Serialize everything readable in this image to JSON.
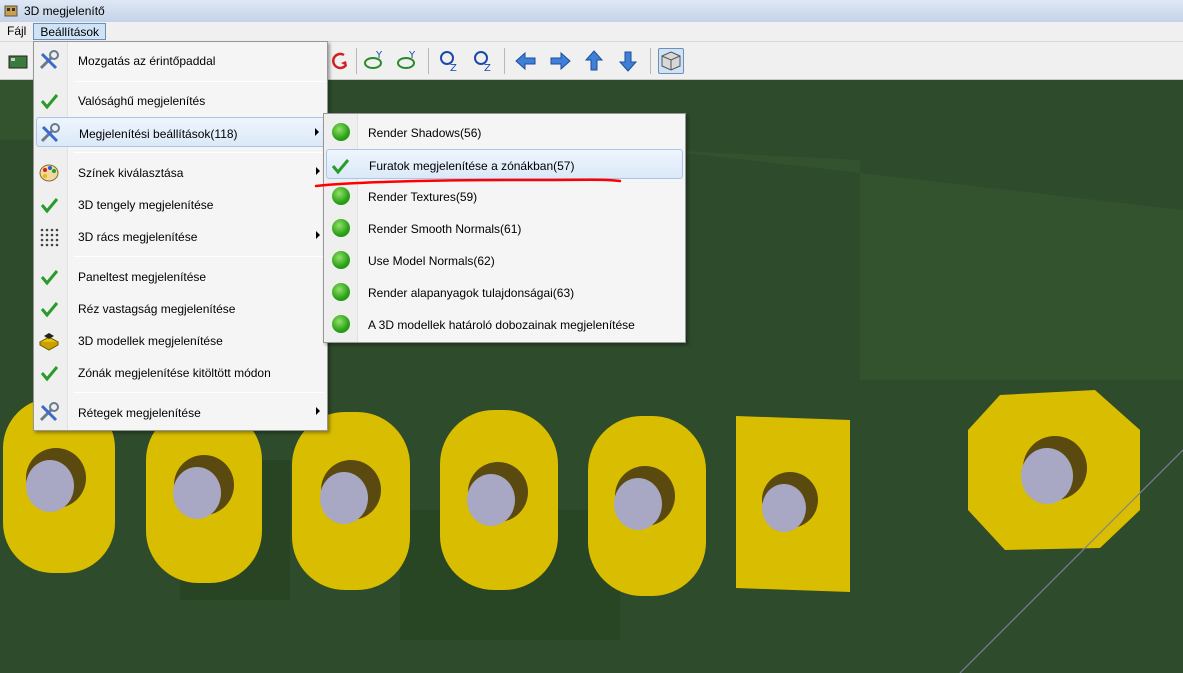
{
  "window": {
    "title": "3D megjelenítő"
  },
  "menubar": {
    "items": [
      "Fájl",
      "Beállítások"
    ]
  },
  "main_menu": {
    "items": [
      {
        "label": "Mozgatás az érintőpaddal",
        "icon": "tools-icon",
        "has_submenu": false
      },
      {
        "label": "Valósághű megjelenítés",
        "icon": "check-icon",
        "has_submenu": false
      },
      {
        "label": "Megjelenítési beállítások(118)",
        "icon": "tools-icon",
        "has_submenu": true,
        "highlighted": true
      },
      {
        "label": "Színek kiválasztása",
        "icon": "palette-icon",
        "has_submenu": true
      },
      {
        "label": "3D tengely megjelenítése",
        "icon": "check-icon",
        "has_submenu": false
      },
      {
        "label": "3D rács megjelenítése",
        "icon": "grid-icon",
        "has_submenu": true
      },
      {
        "label": "Paneltest megjelenítése",
        "icon": "check-icon",
        "has_submenu": false
      },
      {
        "label": "Réz vastagság megjelenítése",
        "icon": "check-icon",
        "has_submenu": false
      },
      {
        "label": "3D modellek megjelenítése",
        "icon": "3d-model-icon",
        "has_submenu": false
      },
      {
        "label": "Zónák megjelenítése kitöltött módon",
        "icon": "check-icon",
        "has_submenu": false
      },
      {
        "label": "Rétegek megjelenítése",
        "icon": "tools-icon",
        "has_submenu": true
      }
    ]
  },
  "submenu": {
    "items": [
      {
        "label": "Render Shadows(56)",
        "icon": "green-dot-icon"
      },
      {
        "label": "Furatok megjelenítése a zónákban(57)",
        "icon": "check-icon",
        "highlighted": true
      },
      {
        "label": "Render Textures(59)",
        "icon": "green-dot-icon"
      },
      {
        "label": "Render Smooth Normals(61)",
        "icon": "green-dot-icon"
      },
      {
        "label": "Use Model Normals(62)",
        "icon": "green-dot-icon"
      },
      {
        "label": "Render alapanyagok tulajdonságai(63)",
        "icon": "green-dot-icon"
      },
      {
        "label": "A 3D modellek határoló dobozainak megjelenítése",
        "icon": "green-dot-icon"
      }
    ]
  },
  "colors": {
    "board": "#2d4a2a",
    "copper_pad": "#d9bd00",
    "hole": "#a8a8c4",
    "highlight_line": "#ff0000"
  }
}
